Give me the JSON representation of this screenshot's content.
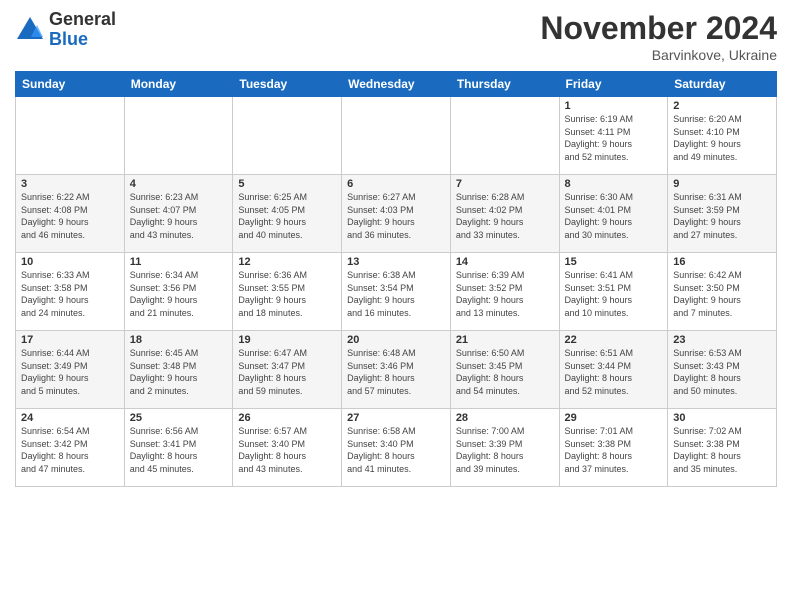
{
  "header": {
    "logo_general": "General",
    "logo_blue": "Blue",
    "month_title": "November 2024",
    "location": "Barvinkove, Ukraine"
  },
  "days_of_week": [
    "Sunday",
    "Monday",
    "Tuesday",
    "Wednesday",
    "Thursday",
    "Friday",
    "Saturday"
  ],
  "weeks": [
    [
      {
        "day": "",
        "info": ""
      },
      {
        "day": "",
        "info": ""
      },
      {
        "day": "",
        "info": ""
      },
      {
        "day": "",
        "info": ""
      },
      {
        "day": "",
        "info": ""
      },
      {
        "day": "1",
        "info": "Sunrise: 6:19 AM\nSunset: 4:11 PM\nDaylight: 9 hours\nand 52 minutes."
      },
      {
        "day": "2",
        "info": "Sunrise: 6:20 AM\nSunset: 4:10 PM\nDaylight: 9 hours\nand 49 minutes."
      }
    ],
    [
      {
        "day": "3",
        "info": "Sunrise: 6:22 AM\nSunset: 4:08 PM\nDaylight: 9 hours\nand 46 minutes."
      },
      {
        "day": "4",
        "info": "Sunrise: 6:23 AM\nSunset: 4:07 PM\nDaylight: 9 hours\nand 43 minutes."
      },
      {
        "day": "5",
        "info": "Sunrise: 6:25 AM\nSunset: 4:05 PM\nDaylight: 9 hours\nand 40 minutes."
      },
      {
        "day": "6",
        "info": "Sunrise: 6:27 AM\nSunset: 4:03 PM\nDaylight: 9 hours\nand 36 minutes."
      },
      {
        "day": "7",
        "info": "Sunrise: 6:28 AM\nSunset: 4:02 PM\nDaylight: 9 hours\nand 33 minutes."
      },
      {
        "day": "8",
        "info": "Sunrise: 6:30 AM\nSunset: 4:01 PM\nDaylight: 9 hours\nand 30 minutes."
      },
      {
        "day": "9",
        "info": "Sunrise: 6:31 AM\nSunset: 3:59 PM\nDaylight: 9 hours\nand 27 minutes."
      }
    ],
    [
      {
        "day": "10",
        "info": "Sunrise: 6:33 AM\nSunset: 3:58 PM\nDaylight: 9 hours\nand 24 minutes."
      },
      {
        "day": "11",
        "info": "Sunrise: 6:34 AM\nSunset: 3:56 PM\nDaylight: 9 hours\nand 21 minutes."
      },
      {
        "day": "12",
        "info": "Sunrise: 6:36 AM\nSunset: 3:55 PM\nDaylight: 9 hours\nand 18 minutes."
      },
      {
        "day": "13",
        "info": "Sunrise: 6:38 AM\nSunset: 3:54 PM\nDaylight: 9 hours\nand 16 minutes."
      },
      {
        "day": "14",
        "info": "Sunrise: 6:39 AM\nSunset: 3:52 PM\nDaylight: 9 hours\nand 13 minutes."
      },
      {
        "day": "15",
        "info": "Sunrise: 6:41 AM\nSunset: 3:51 PM\nDaylight: 9 hours\nand 10 minutes."
      },
      {
        "day": "16",
        "info": "Sunrise: 6:42 AM\nSunset: 3:50 PM\nDaylight: 9 hours\nand 7 minutes."
      }
    ],
    [
      {
        "day": "17",
        "info": "Sunrise: 6:44 AM\nSunset: 3:49 PM\nDaylight: 9 hours\nand 5 minutes."
      },
      {
        "day": "18",
        "info": "Sunrise: 6:45 AM\nSunset: 3:48 PM\nDaylight: 9 hours\nand 2 minutes."
      },
      {
        "day": "19",
        "info": "Sunrise: 6:47 AM\nSunset: 3:47 PM\nDaylight: 8 hours\nand 59 minutes."
      },
      {
        "day": "20",
        "info": "Sunrise: 6:48 AM\nSunset: 3:46 PM\nDaylight: 8 hours\nand 57 minutes."
      },
      {
        "day": "21",
        "info": "Sunrise: 6:50 AM\nSunset: 3:45 PM\nDaylight: 8 hours\nand 54 minutes."
      },
      {
        "day": "22",
        "info": "Sunrise: 6:51 AM\nSunset: 3:44 PM\nDaylight: 8 hours\nand 52 minutes."
      },
      {
        "day": "23",
        "info": "Sunrise: 6:53 AM\nSunset: 3:43 PM\nDaylight: 8 hours\nand 50 minutes."
      }
    ],
    [
      {
        "day": "24",
        "info": "Sunrise: 6:54 AM\nSunset: 3:42 PM\nDaylight: 8 hours\nand 47 minutes."
      },
      {
        "day": "25",
        "info": "Sunrise: 6:56 AM\nSunset: 3:41 PM\nDaylight: 8 hours\nand 45 minutes."
      },
      {
        "day": "26",
        "info": "Sunrise: 6:57 AM\nSunset: 3:40 PM\nDaylight: 8 hours\nand 43 minutes."
      },
      {
        "day": "27",
        "info": "Sunrise: 6:58 AM\nSunset: 3:40 PM\nDaylight: 8 hours\nand 41 minutes."
      },
      {
        "day": "28",
        "info": "Sunrise: 7:00 AM\nSunset: 3:39 PM\nDaylight: 8 hours\nand 39 minutes."
      },
      {
        "day": "29",
        "info": "Sunrise: 7:01 AM\nSunset: 3:38 PM\nDaylight: 8 hours\nand 37 minutes."
      },
      {
        "day": "30",
        "info": "Sunrise: 7:02 AM\nSunset: 3:38 PM\nDaylight: 8 hours\nand 35 minutes."
      }
    ]
  ]
}
